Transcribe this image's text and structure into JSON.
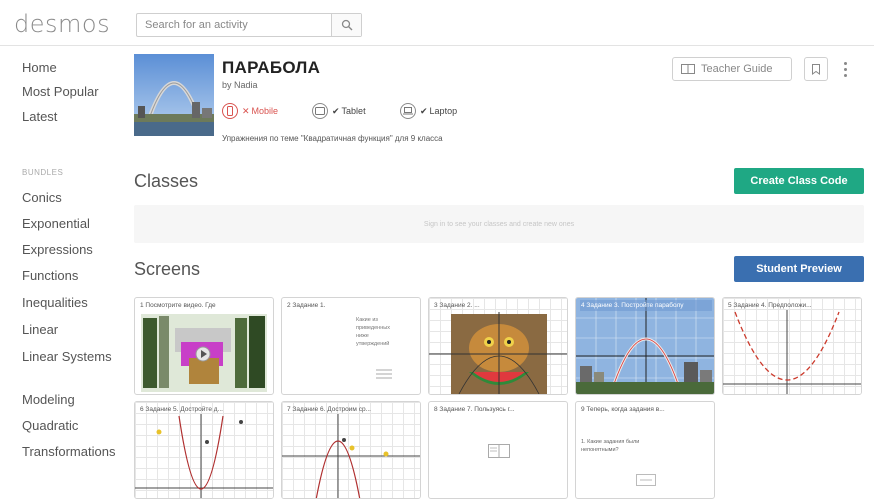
{
  "topbar": {
    "logo": "desmos",
    "search_placeholder": "Search for an activity"
  },
  "sidebar": {
    "nav": [
      "Home",
      "Most Popular",
      "Latest"
    ],
    "bundles_label": "BUNDLES",
    "bundles": [
      "Conics",
      "Exponential",
      "Expressions",
      "Functions",
      "Inequalities",
      "Linear",
      "Linear Systems",
      "Modeling",
      "Quadratic",
      "Transformations"
    ]
  },
  "activity": {
    "title": "ПАРАБОЛА",
    "author": "by Nadia",
    "devices": [
      {
        "label": "Mobile",
        "mark": "✕",
        "color": "#d9534f"
      },
      {
        "label": "Tablet",
        "mark": "✔",
        "color": "#444444"
      },
      {
        "label": "Laptop",
        "mark": "✔",
        "color": "#444444"
      }
    ],
    "description": "Упражнения по теме \"Квадратичная функция\" для 9 класса",
    "teacher_guide_label": "Teacher Guide"
  },
  "classes": {
    "heading": "Classes",
    "create_button": "Create Class Code",
    "empty_text": "Sign in to see your classes and create new ones"
  },
  "screens": {
    "heading": "Screens",
    "preview_button": "Student Preview",
    "cards": [
      {
        "title": "1 Посмотрите видео. Где"
      },
      {
        "title": "2 Задание 1.",
        "body_text": [
          "Какие из",
          "приведенных",
          "ниже",
          "утверждений"
        ]
      },
      {
        "title": "3 Задание 2. ..."
      },
      {
        "title": "4 Задание 3. Постройте параболу"
      },
      {
        "title": "5 Задание 4. Предположи..."
      },
      {
        "title": "6 Задание 5. Достройте д..."
      },
      {
        "title": "7 Задание 6. Достроим ср..."
      },
      {
        "title": "8 Задание 7. Пользуясь г..."
      },
      {
        "title": "9 Теперь, когда задания в...",
        "body_text": [
          "1. Какие задания были",
          "непонятными?"
        ]
      }
    ]
  },
  "colors": {
    "green": "#1fa884",
    "blue": "#3a6fb0",
    "red": "#d9534f"
  }
}
